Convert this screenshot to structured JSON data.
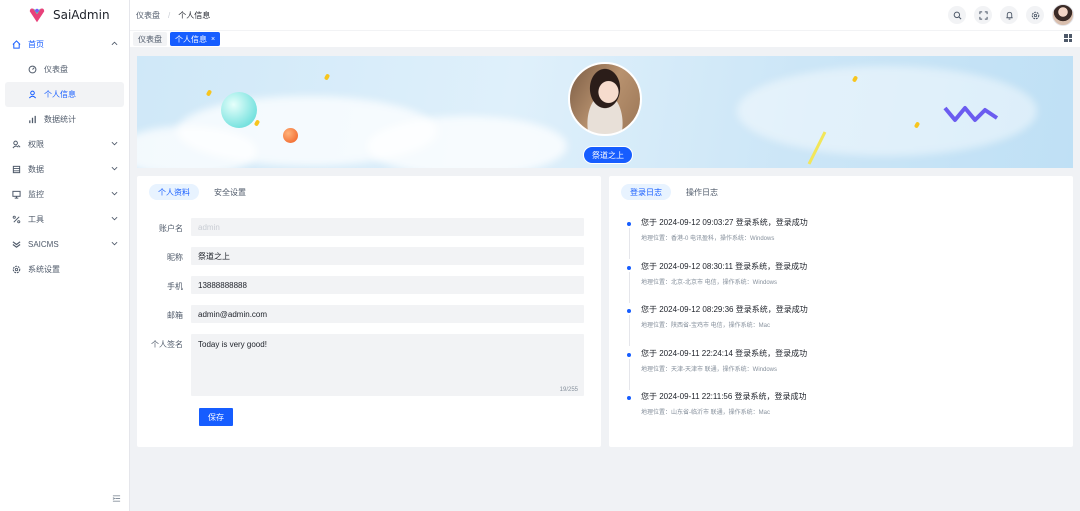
{
  "app": {
    "name": "SaiAdmin"
  },
  "sidebar": {
    "items": [
      {
        "label": "首页",
        "icon": "home-icon"
      },
      {
        "label": "仪表盘",
        "icon": "dashboard-icon"
      },
      {
        "label": "个人信息",
        "icon": "user-icon"
      },
      {
        "label": "数据统计",
        "icon": "bar-chart-icon"
      },
      {
        "label": "权限",
        "icon": "permission-icon"
      },
      {
        "label": "数据",
        "icon": "data-icon"
      },
      {
        "label": "监控",
        "icon": "monitor-icon"
      },
      {
        "label": "工具",
        "icon": "tool-icon"
      },
      {
        "label": "SAICMS",
        "icon": "cms-icon"
      },
      {
        "label": "系统设置",
        "icon": "settings-icon"
      }
    ]
  },
  "header": {
    "breadcrumb": [
      "仪表盘",
      "个人信息"
    ],
    "separator": "/"
  },
  "tabs": [
    {
      "label": "仪表盘"
    },
    {
      "label": "个人信息",
      "close": "×"
    }
  ],
  "profile": {
    "display_name": "祭道之上"
  },
  "left_card": {
    "tabs": [
      "个人资料",
      "安全设置"
    ],
    "fields": {
      "username": {
        "label": "账户名",
        "value": "admin"
      },
      "nickname": {
        "label": "昵称",
        "value": "祭道之上"
      },
      "phone": {
        "label": "手机",
        "value": "13888888888"
      },
      "email": {
        "label": "邮箱",
        "value": "admin@admin.com"
      },
      "signature": {
        "label": "个人签名",
        "value": "Today is very good!",
        "count": "19/255"
      }
    },
    "save_label": "保存"
  },
  "right_card": {
    "tabs": [
      "登录日志",
      "操作日志"
    ],
    "logs": [
      {
        "title": "您于 2024-09-12 09:03:27 登录系统，登录成功",
        "sub": "地理位置：香港-0 电讯盈科，操作系统：Windows"
      },
      {
        "title": "您于 2024-09-12 08:30:11 登录系统，登录成功",
        "sub": "地理位置：北京-北京市 电信，操作系统：Windows"
      },
      {
        "title": "您于 2024-09-12 08:29:36 登录系统，登录成功",
        "sub": "地理位置：陕西省-宝鸡市 电信，操作系统：Mac"
      },
      {
        "title": "您于 2024-09-11 22:24:14 登录系统，登录成功",
        "sub": "地理位置：天津-天津市 联通，操作系统：Windows"
      },
      {
        "title": "您于 2024-09-11 22:11:56 登录系统，登录成功",
        "sub": "地理位置：山东省-临沂市 联通，操作系统：Mac"
      }
    ]
  },
  "colors": {
    "primary": "#165dff",
    "bg": "#f0f2f5"
  }
}
